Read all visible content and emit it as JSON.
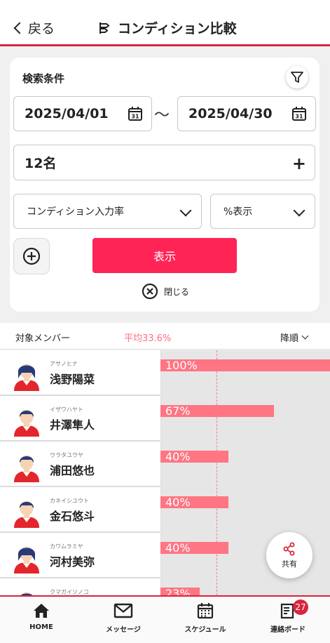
{
  "header": {
    "back_label": "戻る",
    "title": "コンディション比較"
  },
  "search": {
    "title": "検索条件",
    "date_from": "2025/04/01",
    "date_separator": "〜",
    "date_to": "2025/04/30",
    "members": "12名",
    "metric": "コンディション入力率",
    "display_mode": "%表示",
    "submit_label": "表示",
    "close_label": "閉じる"
  },
  "list_header": {
    "label": "対象メンバー",
    "average": "平均33.6%",
    "sort": "降順"
  },
  "members": [
    {
      "kana": "アサノヒナ",
      "name": "浅野陽菜",
      "value": 100,
      "label": "100%",
      "gender": "female"
    },
    {
      "kana": "イザワハヤト",
      "name": "井澤隼人",
      "value": 67,
      "label": "67%",
      "gender": "male"
    },
    {
      "kana": "ウラタユウヤ",
      "name": "浦田悠也",
      "value": 40,
      "label": "40%",
      "gender": "male"
    },
    {
      "kana": "カネイシユウト",
      "name": "金石悠斗",
      "value": 40,
      "label": "40%",
      "gender": "male"
    },
    {
      "kana": "カワムラミヤ",
      "name": "河村美弥",
      "value": 40,
      "label": "40%",
      "gender": "female"
    },
    {
      "kana": "クマガイソノコ",
      "name": "",
      "value": 23,
      "label": "23%",
      "gender": "female"
    }
  ],
  "share_label": "共有",
  "tabs": [
    {
      "label": "HOME",
      "icon": "home-icon"
    },
    {
      "label": "メッセージ",
      "icon": "mail-icon"
    },
    {
      "label": "スケジュール",
      "icon": "calendar-icon"
    },
    {
      "label": "連絡ボード",
      "icon": "board-icon",
      "badge": "27"
    }
  ],
  "colors": {
    "accent": "#d7263d",
    "button": "#ff2456",
    "bar": "#ff7583"
  }
}
